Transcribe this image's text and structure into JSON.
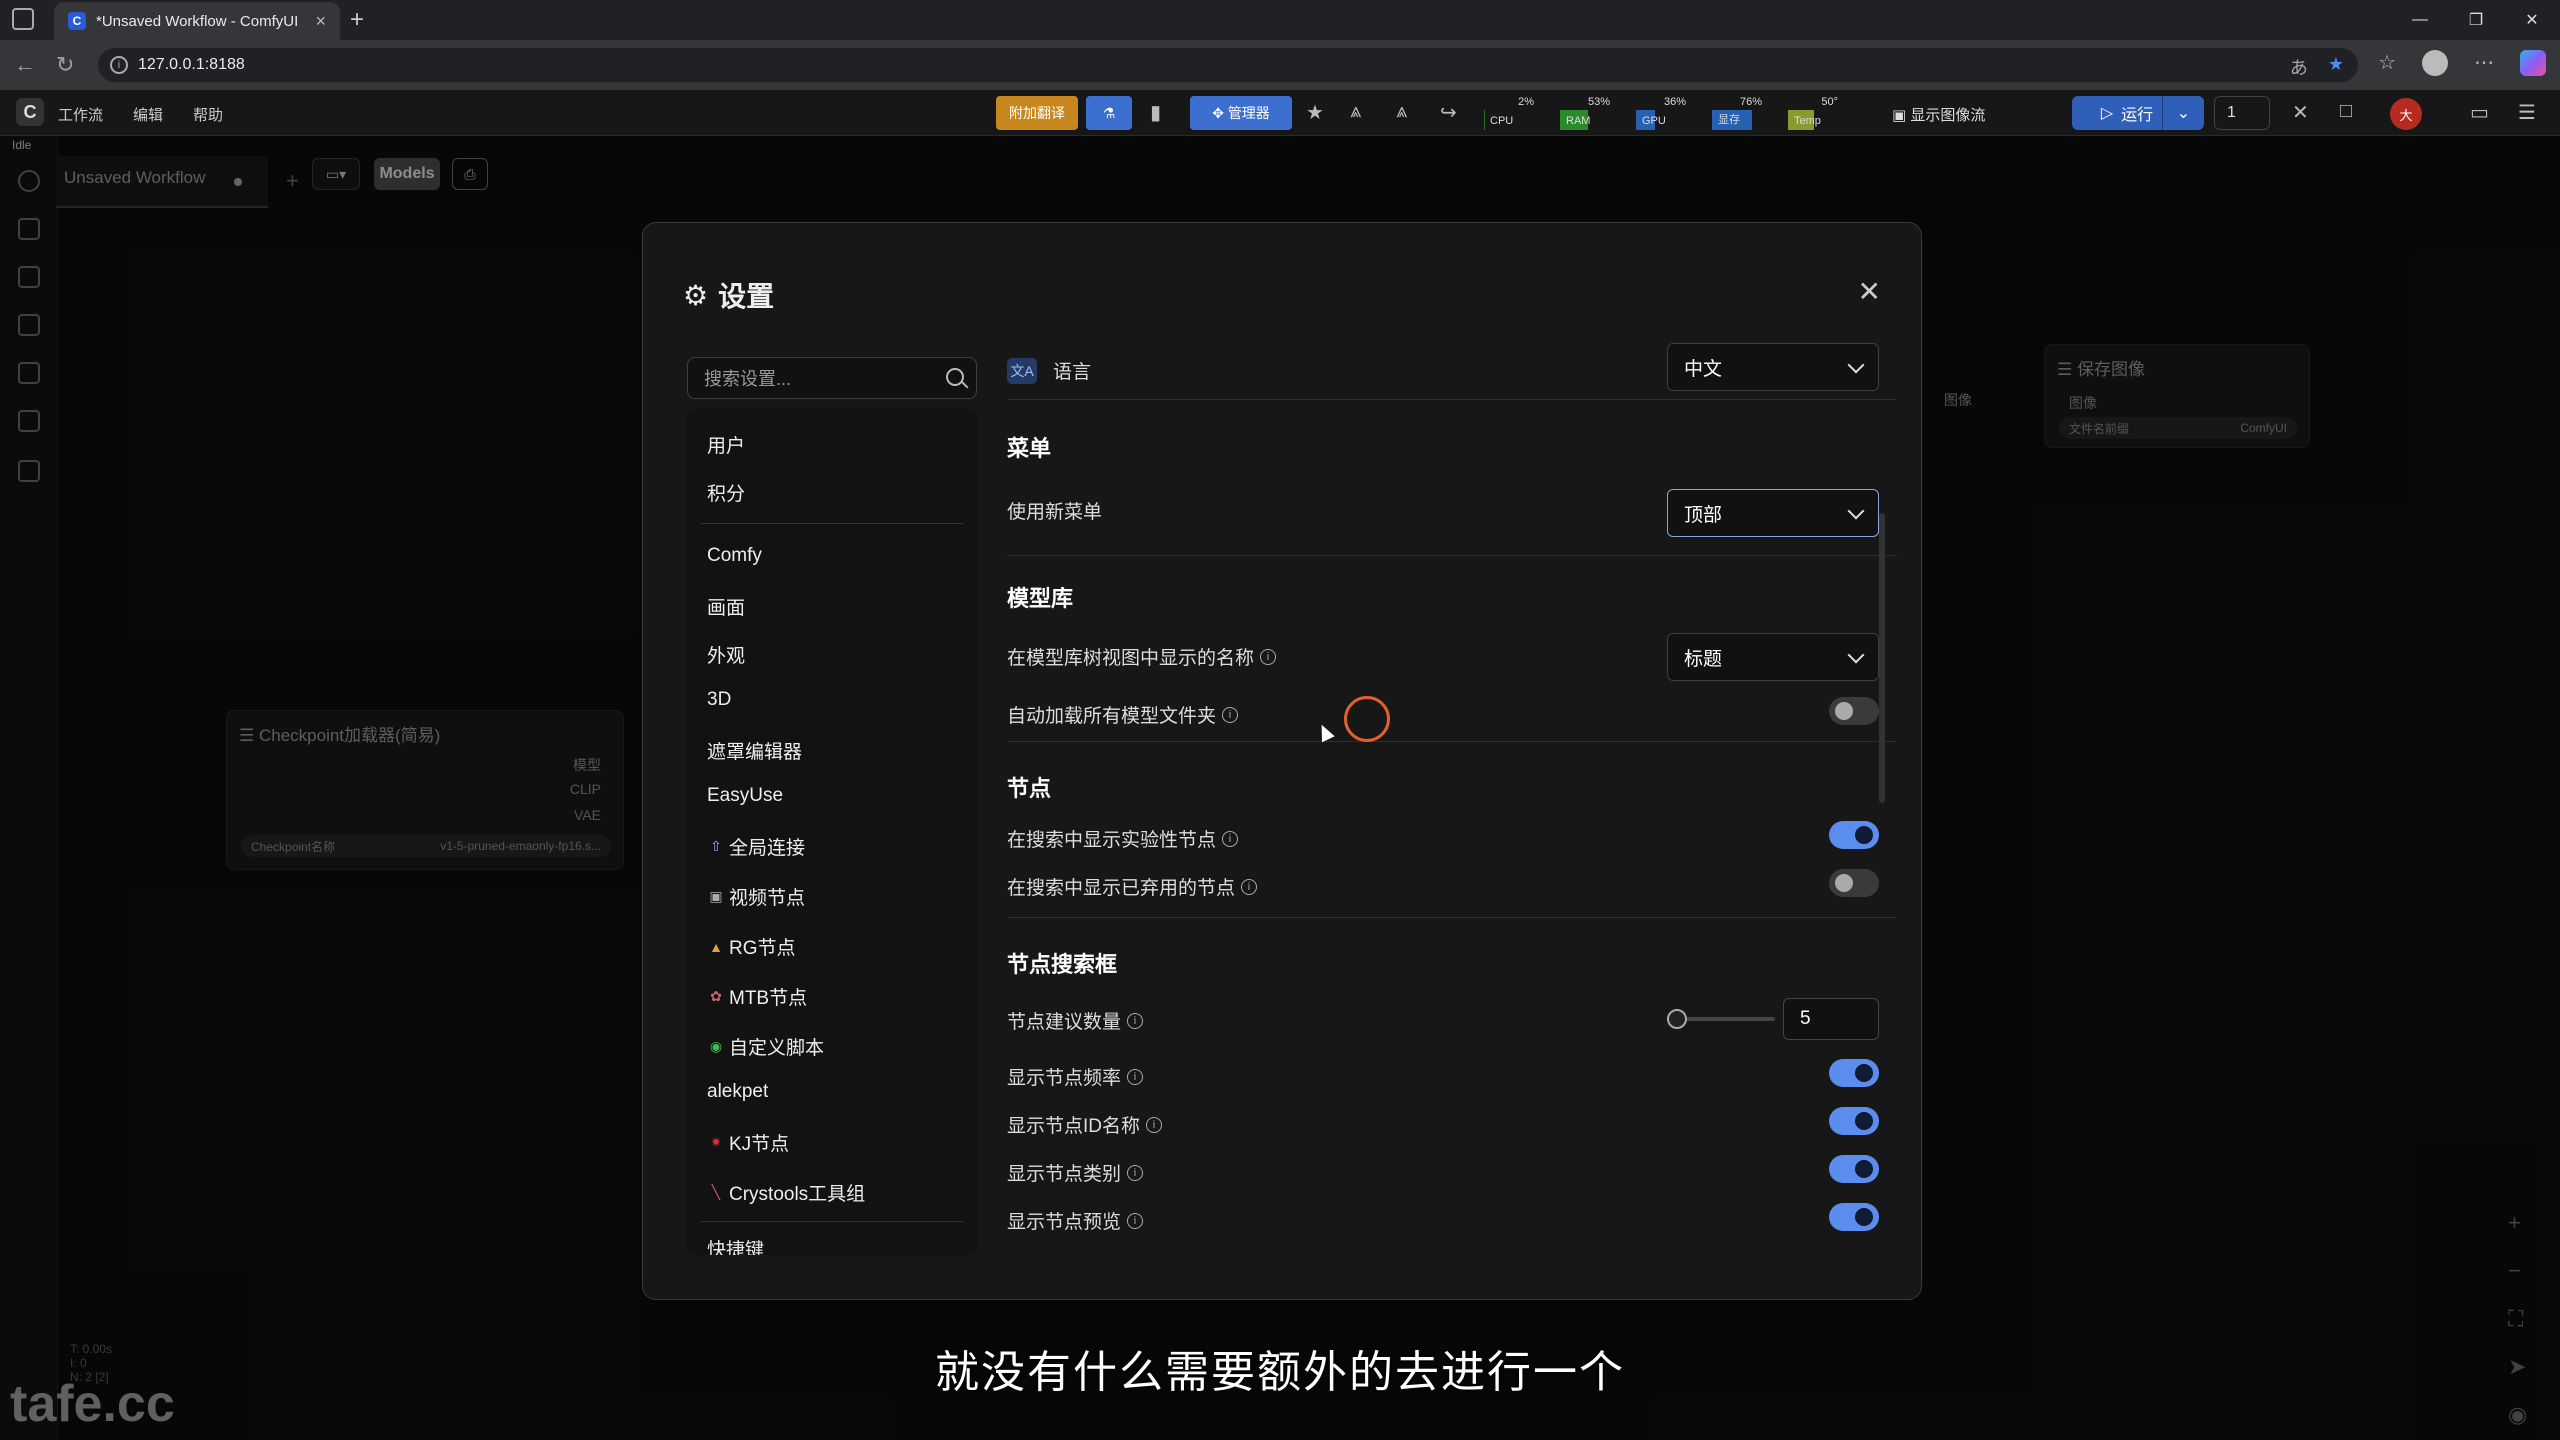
{
  "browser": {
    "tab_title": "*Unsaved Workflow - ComfyUI",
    "url": "127.0.0.1:8188",
    "new_tab": "+",
    "win": [
      "—",
      "❐",
      "✕"
    ]
  },
  "appbar": {
    "menu": [
      "工作流",
      "编辑",
      "帮助"
    ],
    "translate_btn": "附加翻译",
    "manager_btn": "管理器",
    "monitors": [
      {
        "label": "CPU",
        "pct": "2%",
        "level": 0.02,
        "color": "#2b6b2b"
      },
      {
        "label": "RAM",
        "pct": "53%",
        "level": 0.53,
        "color": "#2b8a2b"
      },
      {
        "label": "GPU",
        "pct": "36%",
        "level": 0.36,
        "color": "#2760b0"
      },
      {
        "label": "显存",
        "pct": "76%",
        "level": 0.76,
        "color": "#2760b0"
      },
      {
        "label": "Temp",
        "pct": "50°",
        "level": 0.5,
        "color": "#8a9a2b"
      }
    ],
    "show_image": "显示图像流",
    "run": "运行",
    "run_count": "1",
    "user": "大"
  },
  "rail": {
    "status": "Idle"
  },
  "workflow": {
    "tab": "Unsaved Workflow",
    "models_btn": "Models"
  },
  "nodes": {
    "checkpoint": {
      "title": "Checkpoint加载器(简易)",
      "outputs": [
        "模型",
        "CLIP",
        "VAE"
      ],
      "widget_label": "Checkpoint名称",
      "widget_value": "v1-5-pruned-emaonly-fp16.s..."
    },
    "save": {
      "title": "保存图像",
      "input": "图像",
      "left_output": "图像",
      "widget_label": "文件名前缀",
      "widget_value": "ComfyUI"
    }
  },
  "settings": {
    "title": "设置",
    "search_placeholder": "搜索设置...",
    "categories": [
      {
        "label": "用户"
      },
      {
        "label": "积分"
      },
      {
        "label": "Comfy"
      },
      {
        "label": "画面"
      },
      {
        "label": "外观"
      },
      {
        "label": "3D"
      },
      {
        "label": "遮罩编辑器"
      },
      {
        "label": "EasyUse"
      },
      {
        "label": "全局连接",
        "icon": "⇧",
        "icon_color": "#8fa7ff"
      },
      {
        "label": "视频节点",
        "icon": "▣",
        "icon_color": "#aaa"
      },
      {
        "label": "RG节点",
        "icon": "▲",
        "icon_color": "#e0a040"
      },
      {
        "label": "MTB节点",
        "icon": "✿",
        "icon_color": "#cc6677"
      },
      {
        "label": "自定义脚本",
        "icon": "◉",
        "icon_color": "#3fb950"
      },
      {
        "label": "alekpet"
      },
      {
        "label": "KJ节点",
        "icon": "✷",
        "icon_color": "#e03030"
      },
      {
        "label": "Crystools工具组",
        "icon": "╲",
        "icon_color": "#e05090"
      },
      {
        "label": "快捷键"
      }
    ],
    "language": {
      "label": "语言",
      "value": "中文"
    },
    "menu_section": "菜单",
    "use_new_menu": {
      "label": "使用新菜单",
      "value": "顶部"
    },
    "model_library_section": "模型库",
    "model_name_display": {
      "label": "在模型库树视图中显示的名称",
      "value": "标题"
    },
    "auto_load_models": {
      "label": "自动加载所有模型文件夹",
      "on": false
    },
    "nodes_section": "节点",
    "show_experimental": {
      "label": "在搜索中显示实验性节点",
      "on": true
    },
    "show_deprecated": {
      "label": "在搜索中显示已弃用的节点",
      "on": false
    },
    "search_box_section": "节点搜索框",
    "suggestion_count": {
      "label": "节点建议数量",
      "value": "5"
    },
    "show_frequency": {
      "label": "显示节点频率",
      "on": true
    },
    "show_id_name": {
      "label": "显示节点ID名称",
      "on": true
    },
    "show_category": {
      "label": "显示节点类别",
      "on": true
    },
    "show_preview": {
      "label": "显示节点预览",
      "on": true
    }
  },
  "subtitle": "就没有什么需要额外的去进行一个",
  "watermark": "tafe.cc"
}
